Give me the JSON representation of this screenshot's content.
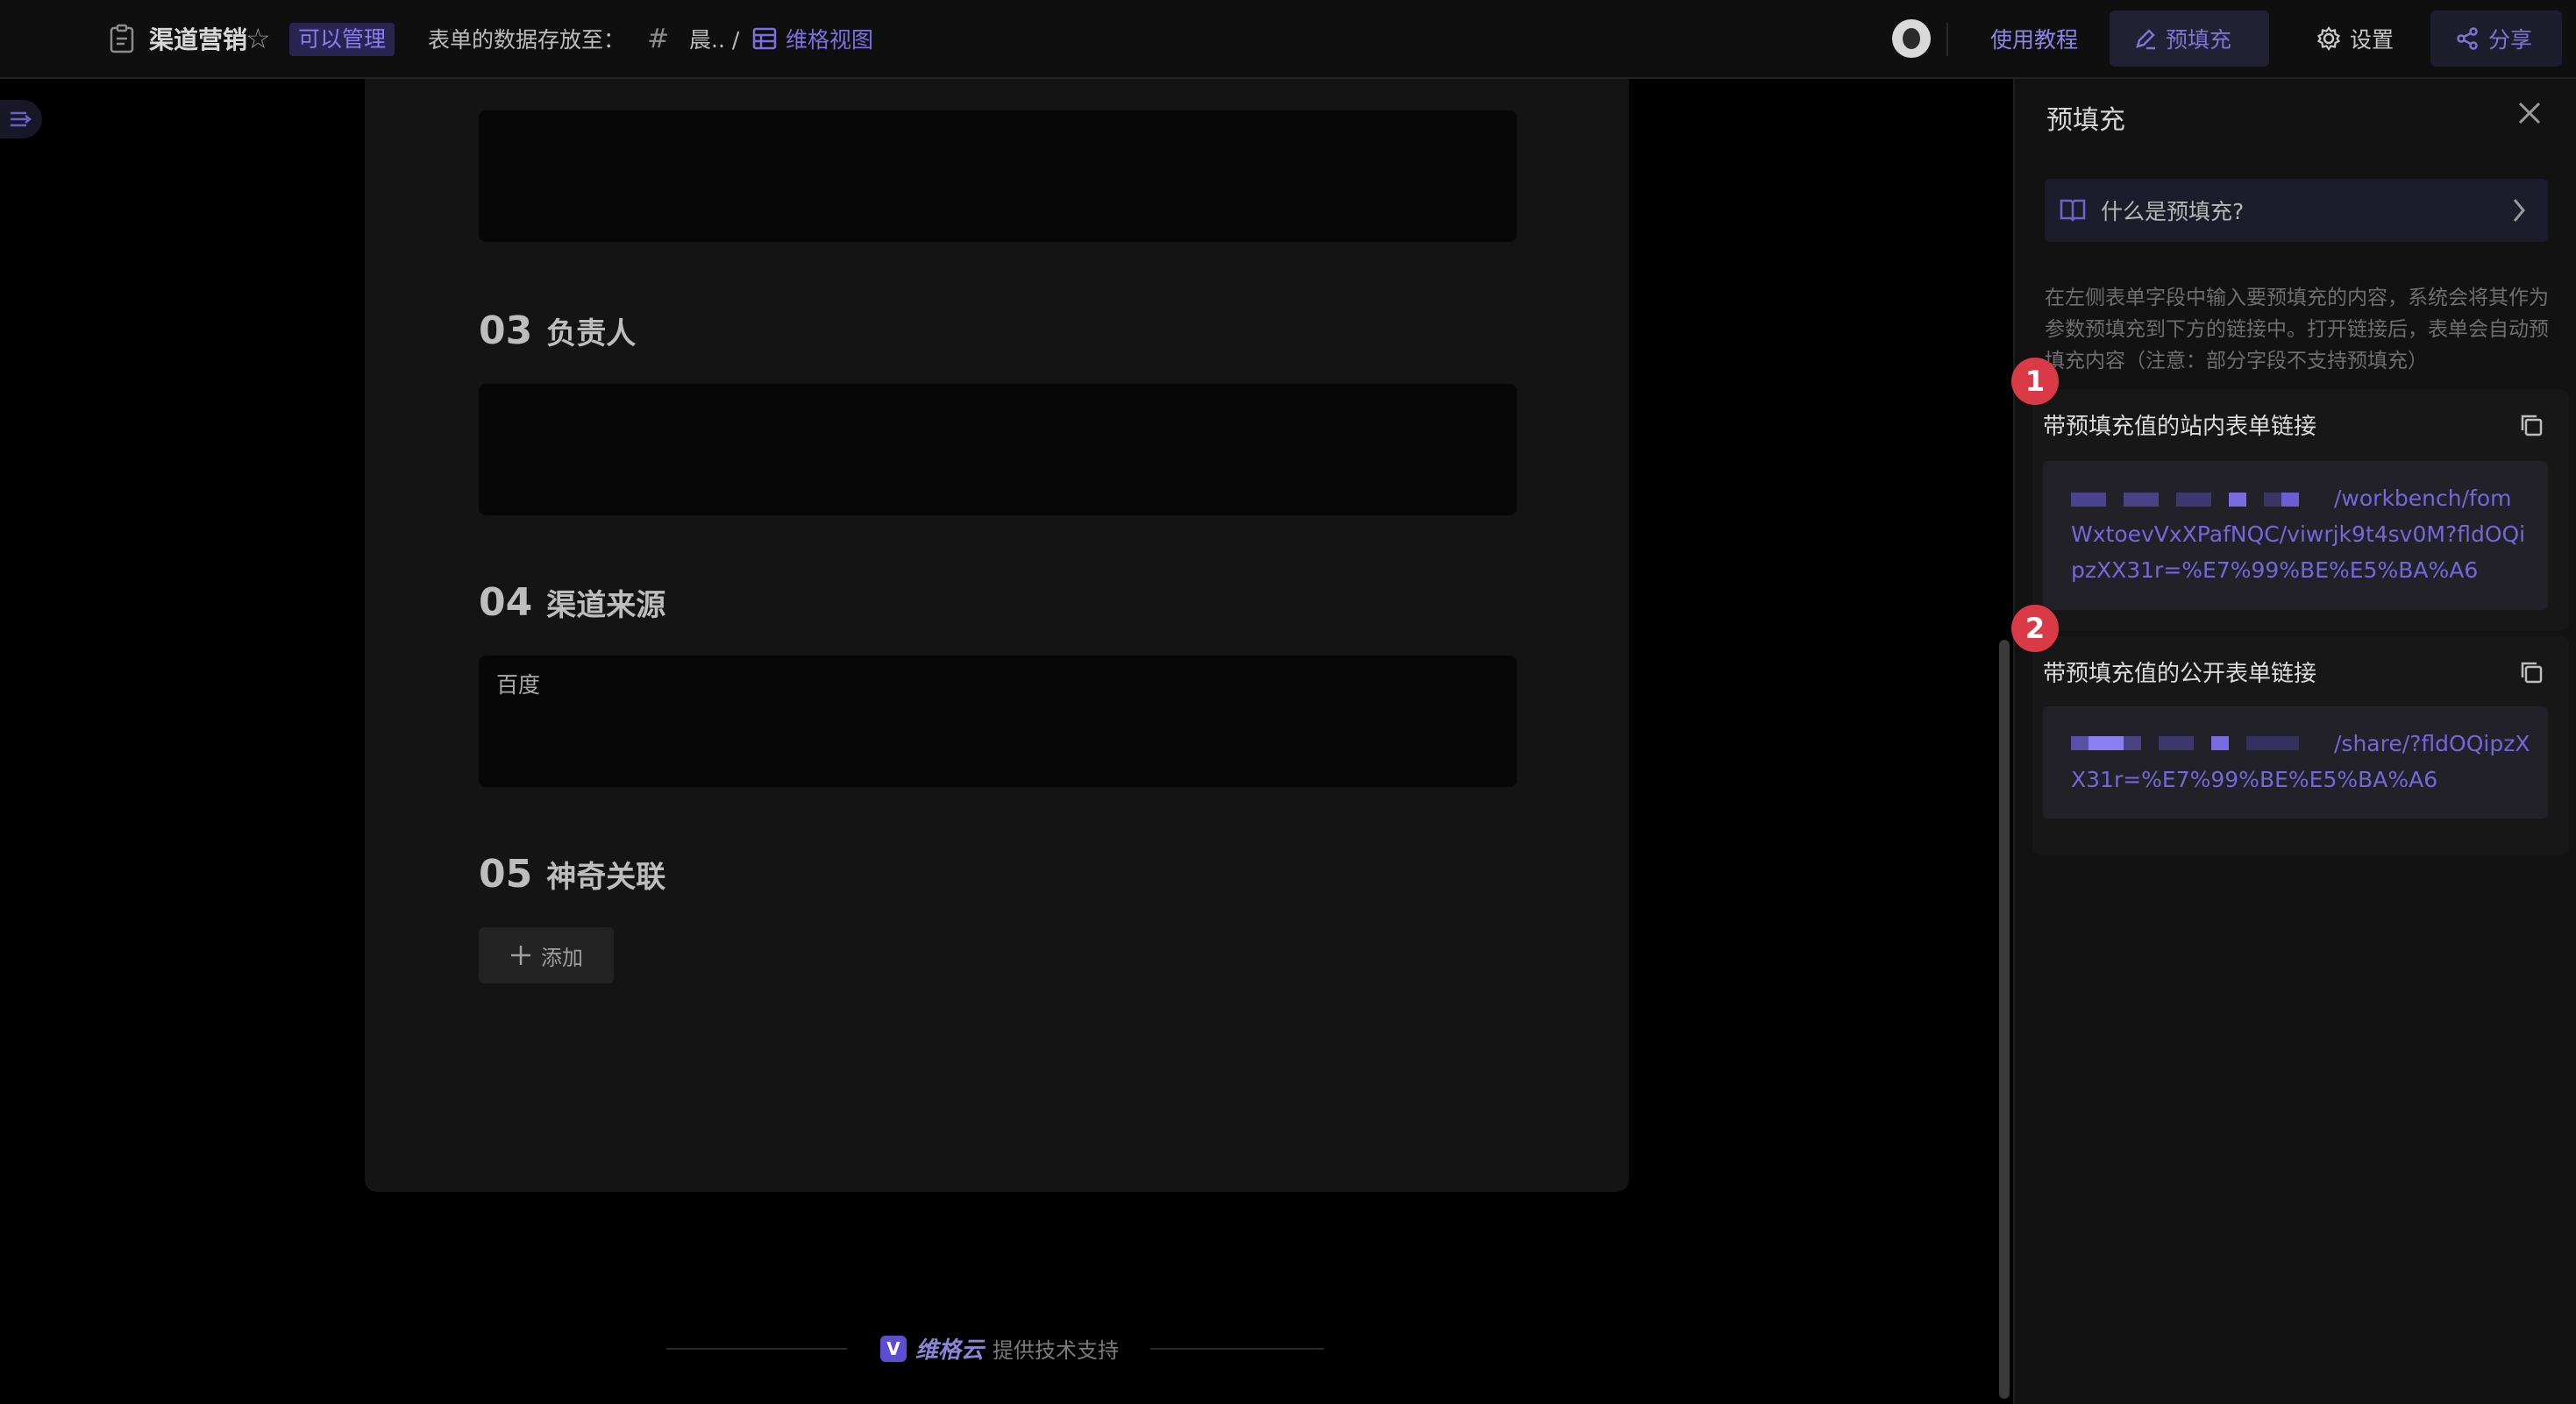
{
  "topbar": {
    "title": "渠道营销",
    "badge": "可以管理",
    "store_label": "表单的数据存放至：",
    "folder": "晨.. /",
    "view_link": "维格视图",
    "tutorial": "使用教程",
    "prefill": "预填充",
    "settings": "设置",
    "share": "分享"
  },
  "form": {
    "sections": [
      {
        "num": "03",
        "name": "负责人",
        "value": ""
      },
      {
        "num": "04",
        "name": "渠道来源",
        "value": "百度"
      },
      {
        "num": "05",
        "name": "神奇关联"
      }
    ],
    "add_label": "添加"
  },
  "footer": {
    "brand": "维格云",
    "text": "提供技术支持"
  },
  "panel": {
    "title": "预填充",
    "help": "什么是预填充?",
    "description": "在左侧表单字段中输入要预填充的内容，系统会将其作为参数预填充到下方的链接中。打开链接后，表单会自动预填充内容（注意：部分字段不支持预填充）",
    "cards": [
      {
        "badge": "1",
        "title": "带预填充值的站内表单链接",
        "link_tail": "/workbench/fomWxtoevVxXPafNQC/viwrjk9t4sv0M?fldOQipzXX31r=%E7%99%BE%E5%BA%A6"
      },
      {
        "badge": "2",
        "title": "带预填充值的公开表单链接",
        "link_tail": "/share/?fldOQipzXX31r=%E7%99%BE%E5%BA%A6"
      }
    ]
  },
  "colors": {
    "accent": "#7566dc",
    "badge_red": "#d93a45",
    "background": "#000000"
  }
}
